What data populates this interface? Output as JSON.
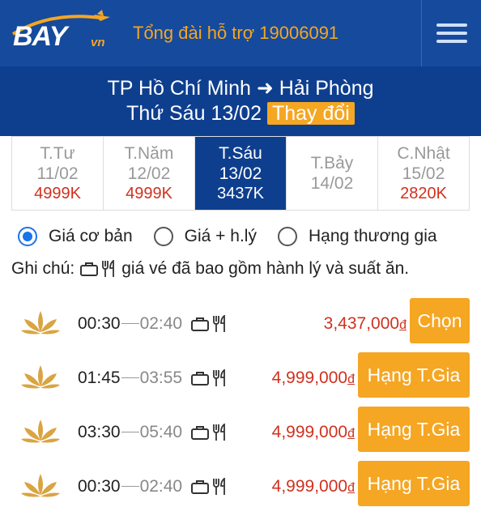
{
  "header": {
    "logo_main": "BAY",
    "logo_suffix": "vn",
    "hotline": "Tổng đài hỗ trợ 19006091",
    "menu_icon": "hamburger-menu-icon"
  },
  "route": {
    "from": "TP Hồ Chí Minh",
    "arrow": "➜",
    "to": "Hải Phòng",
    "date": "Thứ Sáu 13/02",
    "change_label": "Thay đổi"
  },
  "days": [
    {
      "weekday": "T.Tư",
      "date": "11/02",
      "price": "4999K",
      "active": false
    },
    {
      "weekday": "T.Năm",
      "date": "12/02",
      "price": "4999K",
      "active": false
    },
    {
      "weekday": "T.Sáu",
      "date": "13/02",
      "price": "3437K",
      "active": true
    },
    {
      "weekday": "T.Bảy",
      "date": "14/02",
      "price": "",
      "active": false
    },
    {
      "weekday": "C.Nhật",
      "date": "15/02",
      "price": "2820K",
      "active": false
    }
  ],
  "fare_types": [
    {
      "label": "Giá cơ bản",
      "checked": true
    },
    {
      "label": "Giá + h.lý",
      "checked": false
    },
    {
      "label": "Hạng thương gia",
      "checked": false
    }
  ],
  "note": {
    "prefix": "Ghi chú:",
    "text": "giá vé đã bao gồm hành lý và suất ăn.",
    "icons": [
      "luggage-icon",
      "meal-icon"
    ]
  },
  "flights": [
    {
      "depart": "00:30",
      "arrive": "02:40",
      "price": "3,437,000",
      "currency": "đ",
      "button": "Chọn"
    },
    {
      "depart": "01:45",
      "arrive": "03:55",
      "price": "4,999,000",
      "currency": "đ",
      "button": "Hạng T.Gia"
    },
    {
      "depart": "03:30",
      "arrive": "05:40",
      "price": "4,999,000",
      "currency": "đ",
      "button": "Hạng T.Gia"
    },
    {
      "depart": "00:30",
      "arrive": "02:40",
      "price": "4,999,000",
      "currency": "đ",
      "button": "Hạng T.Gia"
    }
  ],
  "colors": {
    "primary": "#164a9c",
    "accent": "#f5a623",
    "price": "#d0311e",
    "radio": "#1a73e8"
  }
}
